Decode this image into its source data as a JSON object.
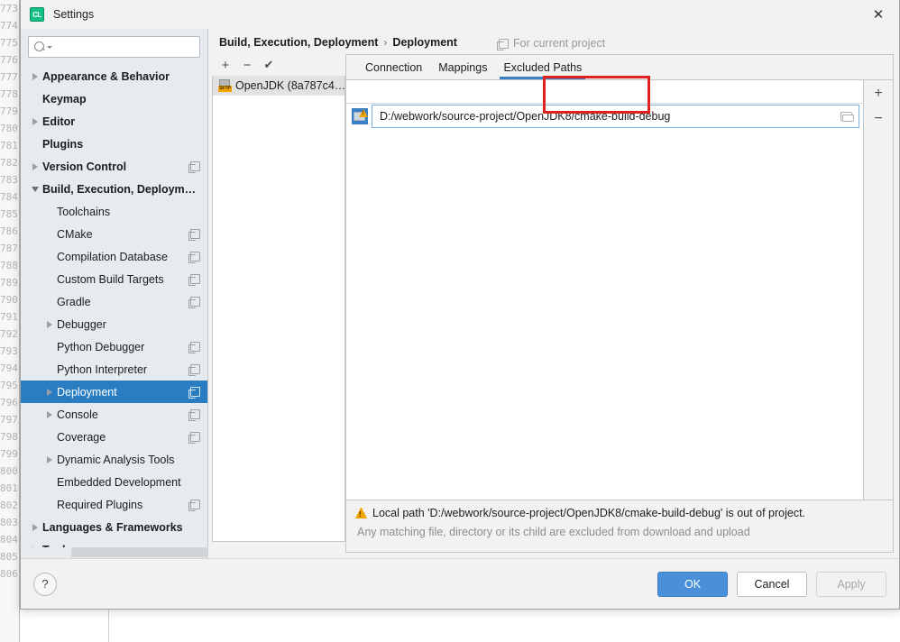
{
  "backdrop": {
    "line_numbers": [
      "773",
      "774",
      "775",
      "776",
      "777",
      "778",
      "779",
      "780",
      "781",
      "782",
      "783",
      "784",
      "785",
      "786",
      "787",
      "788",
      "789",
      "790",
      "791",
      "792",
      "793",
      "794",
      "795",
      "796",
      "797",
      "798",
      "799",
      "800",
      "801",
      "802",
      "803",
      "804",
      "805",
      "806"
    ]
  },
  "titlebar": {
    "app_icon_text": "CL",
    "title": "Settings",
    "close_glyph": "✕"
  },
  "sidebar": {
    "search": {
      "value": "",
      "placeholder": ""
    },
    "items": [
      {
        "label": "Appearance & Behavior",
        "indent": 0,
        "arrow": "right",
        "bold": true,
        "copy": false,
        "selected": false
      },
      {
        "label": "Keymap",
        "indent": 0,
        "arrow": "none",
        "bold": true,
        "copy": false,
        "selected": false
      },
      {
        "label": "Editor",
        "indent": 0,
        "arrow": "right",
        "bold": true,
        "copy": false,
        "selected": false
      },
      {
        "label": "Plugins",
        "indent": 0,
        "arrow": "none",
        "bold": true,
        "copy": false,
        "selected": false
      },
      {
        "label": "Version Control",
        "indent": 0,
        "arrow": "right",
        "bold": true,
        "copy": true,
        "selected": false
      },
      {
        "label": "Build, Execution, Deployment",
        "indent": 0,
        "arrow": "down",
        "bold": true,
        "copy": false,
        "selected": false
      },
      {
        "label": "Toolchains",
        "indent": 1,
        "arrow": "none",
        "bold": false,
        "copy": false,
        "selected": false
      },
      {
        "label": "CMake",
        "indent": 1,
        "arrow": "none",
        "bold": false,
        "copy": true,
        "selected": false
      },
      {
        "label": "Compilation Database",
        "indent": 1,
        "arrow": "none",
        "bold": false,
        "copy": true,
        "selected": false
      },
      {
        "label": "Custom Build Targets",
        "indent": 1,
        "arrow": "none",
        "bold": false,
        "copy": true,
        "selected": false
      },
      {
        "label": "Gradle",
        "indent": 1,
        "arrow": "none",
        "bold": false,
        "copy": true,
        "selected": false
      },
      {
        "label": "Debugger",
        "indent": 1,
        "arrow": "right",
        "bold": false,
        "copy": false,
        "selected": false
      },
      {
        "label": "Python Debugger",
        "indent": 1,
        "arrow": "none",
        "bold": false,
        "copy": true,
        "selected": false
      },
      {
        "label": "Python Interpreter",
        "indent": 1,
        "arrow": "none",
        "bold": false,
        "copy": true,
        "selected": false
      },
      {
        "label": "Deployment",
        "indent": 1,
        "arrow": "right",
        "bold": false,
        "copy": true,
        "selected": true
      },
      {
        "label": "Console",
        "indent": 1,
        "arrow": "right",
        "bold": false,
        "copy": true,
        "selected": false
      },
      {
        "label": "Coverage",
        "indent": 1,
        "arrow": "none",
        "bold": false,
        "copy": true,
        "selected": false
      },
      {
        "label": "Dynamic Analysis Tools",
        "indent": 1,
        "arrow": "right",
        "bold": false,
        "copy": false,
        "selected": false
      },
      {
        "label": "Embedded Development",
        "indent": 1,
        "arrow": "none",
        "bold": false,
        "copy": false,
        "selected": false
      },
      {
        "label": "Required Plugins",
        "indent": 1,
        "arrow": "none",
        "bold": false,
        "copy": true,
        "selected": false
      },
      {
        "label": "Languages & Frameworks",
        "indent": 0,
        "arrow": "right",
        "bold": true,
        "copy": false,
        "selected": false
      },
      {
        "label": "Tools",
        "indent": 0,
        "arrow": "right",
        "bold": true,
        "copy": false,
        "selected": false
      }
    ]
  },
  "content": {
    "breadcrumb": {
      "parent": "Build, Execution, Deployment",
      "separator": "›",
      "current": "Deployment"
    },
    "scope_note": "For current project",
    "list_toolbar": {
      "add": "+",
      "remove": "−",
      "check": "✔"
    },
    "servers": [
      {
        "name": "OpenJDK (8a787c4…",
        "protocol": "SFTP",
        "selected": true
      }
    ],
    "tabs": [
      {
        "label": "Connection",
        "active": false
      },
      {
        "label": "Mappings",
        "active": false
      },
      {
        "label": "Excluded Paths",
        "active": true
      }
    ],
    "side_buttons": {
      "add": "+",
      "remove": "−"
    },
    "excluded_paths": [
      {
        "value": "D:/webwork/source-project/OpenJDK8/cmake-build-debug",
        "warning": true
      }
    ],
    "warning_message": "Local path 'D:/webwork/source-project/OpenJDK8/cmake-build-debug' is out of project.",
    "hint_message": "Any matching file, directory or its child are excluded from download and upload",
    "highlight_color": "#e12020",
    "accent_color": "#3b7fc4"
  },
  "footer": {
    "help": "?",
    "ok": "OK",
    "cancel": "Cancel",
    "apply": "Apply"
  }
}
